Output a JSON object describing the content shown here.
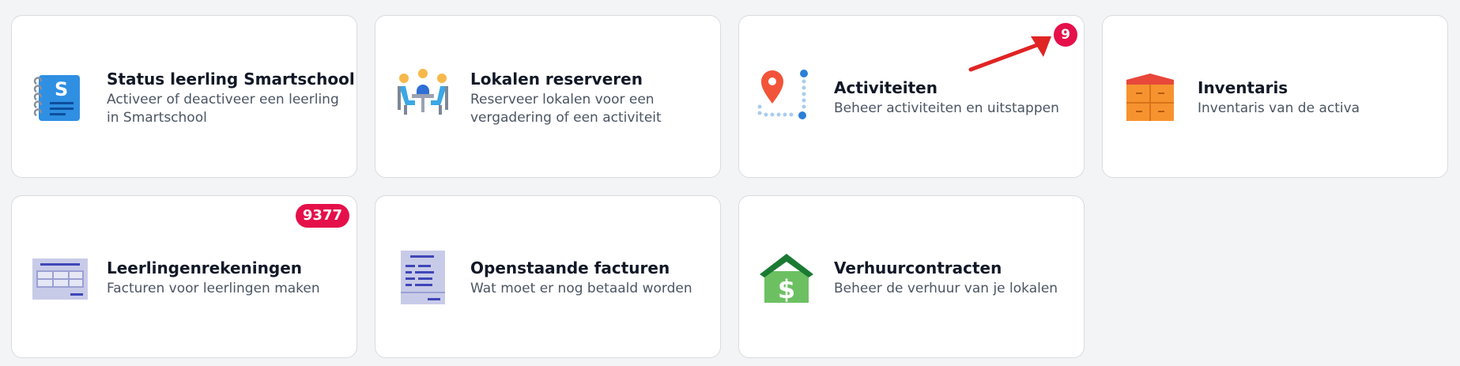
{
  "tiles": [
    {
      "title": "Status leerling Smartschool",
      "description": "Activeer of deactiveer een leerling in Smartschool",
      "icon": "smartschool-notebook-icon"
    },
    {
      "title": "Lokalen reserveren",
      "description": "Reserveer lokalen voor een vergadering of een activiteit",
      "icon": "meeting-room-icon"
    },
    {
      "title": "Activiteiten",
      "description": "Beheer activiteiten en uitstappen",
      "icon": "map-route-icon",
      "badge": "9"
    },
    {
      "title": "Inventaris",
      "description": "Inventaris van de activa",
      "icon": "inventory-boxes-icon"
    },
    {
      "title": "Leerlingenrekeningen",
      "description": "Facturen voor leerlingen maken",
      "icon": "invoice-table-icon",
      "badge": "9377"
    },
    {
      "title": "Openstaande facturen",
      "description": "Wat moet er nog betaald worden",
      "icon": "receipt-list-icon"
    },
    {
      "title": "Verhuurcontracten",
      "description": "Beheer de verhuur van je lokalen",
      "icon": "house-dollar-icon"
    }
  ],
  "colors": {
    "badge": "#e5104a",
    "arrow": "#e02424",
    "background": "#f3f4f6"
  }
}
